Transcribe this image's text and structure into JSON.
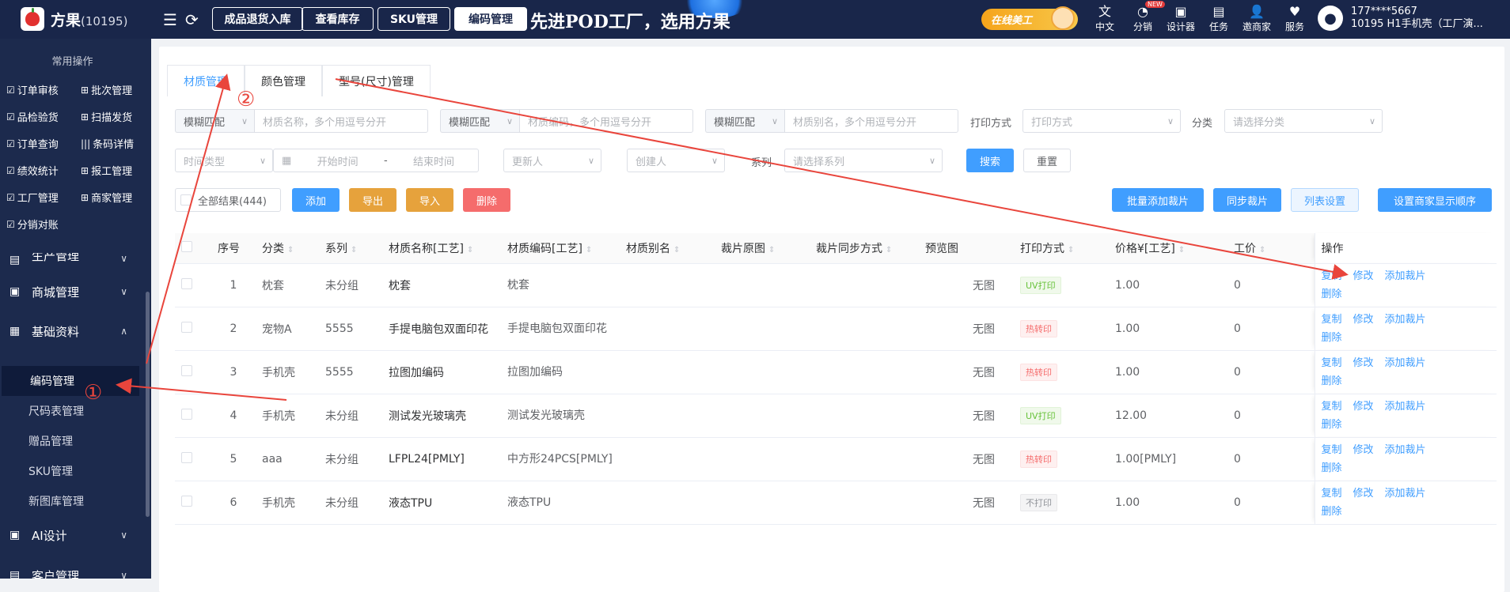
{
  "topbar": {
    "brand": "方果",
    "brand_id": "(10195)",
    "quick_buttons": [
      "成品退货入库",
      "查看库存",
      "SKU管理",
      "编码管理"
    ],
    "slogan": "先进POD工厂，选用方果",
    "online_badge": "在线美工",
    "icons": [
      {
        "label": "中文",
        "icon": "translate-icon"
      },
      {
        "label": "分销",
        "icon": "distribution-icon",
        "badge": "NEW"
      },
      {
        "label": "设计器",
        "icon": "designer-icon"
      },
      {
        "label": "任务",
        "icon": "task-icon"
      },
      {
        "label": "邀商家",
        "icon": "invite-merchant-icon"
      },
      {
        "label": "服务",
        "icon": "service-icon"
      }
    ],
    "user_phone": "177****5667",
    "user_shop": "10195  H1手机壳（工厂演..."
  },
  "sidebar": {
    "common_title": "常用操作",
    "quick": [
      "订单审核",
      "批次管理",
      "品检验货",
      "扫描发货",
      "订单查询",
      "条码详情",
      "绩效统计",
      "报工管理",
      "工厂管理",
      "商家管理",
      "分销对账"
    ],
    "menus": [
      "生产管理",
      "商城管理",
      "基础资料"
    ],
    "sub_items": [
      "编码管理",
      "尺码表管理",
      "赠品管理",
      "SKU管理",
      "新图库管理"
    ],
    "menus_bottom": [
      "AI设计",
      "客户管理"
    ]
  },
  "tabs": [
    "材质管理",
    "颜色管理",
    "型号(尺寸)管理"
  ],
  "filters": {
    "match1": "模糊匹配",
    "material_name_ph": "材质名称，多个用逗号分开",
    "match2": "模糊匹配",
    "material_code_ph": "材质编码，多个用逗号分开",
    "match3": "模糊匹配",
    "material_alias_ph": "材质别名，多个用逗号分开",
    "print_label": "打印方式",
    "print_ph": "打印方式",
    "category_label": "分类",
    "category_ph": "请选择分类",
    "time_type_ph": "时间类型",
    "start_ph": "开始时间",
    "sep": "-",
    "end_ph": "结束时间",
    "updater_ph": "更新人",
    "creator_ph": "创建人",
    "series_label": "系列",
    "series_ph": "请选择系列",
    "search": "搜索",
    "reset": "重置"
  },
  "actions": {
    "all_results": "全部结果(444)",
    "add": "添加",
    "export": "导出",
    "import": "导入",
    "delete": "删除",
    "batch_add_cut": "批量添加裁片",
    "sync_cut": "同步裁片",
    "list_settings": "列表设置",
    "merchant_order": "设置商家显示顺序"
  },
  "table": {
    "headers": [
      "序号",
      "分类",
      "系列",
      "材质名称[工艺]",
      "材质编码[工艺]",
      "材质别名",
      "裁片原图",
      "裁片同步方式",
      "预览图",
      "打印方式",
      "价格¥[工艺]",
      "工价",
      "操作"
    ],
    "rows": [
      {
        "no": "1",
        "category": "枕套",
        "series": "未分组",
        "name": "枕套",
        "code": "枕套",
        "alias": "",
        "preview": "无图",
        "print": "UV打印",
        "print_type": "green",
        "price": "1.00",
        "labor": "0"
      },
      {
        "no": "2",
        "category": "宠物A",
        "series": "5555",
        "name": "手提电脑包双面印花",
        "code": "手提电脑包双面印花",
        "alias": "",
        "preview": "无图",
        "print": "热转印",
        "print_type": "red",
        "price": "1.00",
        "labor": "0"
      },
      {
        "no": "3",
        "category": "手机壳",
        "series": "5555",
        "name": "拉图加编码",
        "code": "拉图加编码",
        "alias": "",
        "preview": "无图",
        "print": "热转印",
        "print_type": "red",
        "price": "1.00",
        "labor": "0"
      },
      {
        "no": "4",
        "category": "手机壳",
        "series": "未分组",
        "name": "测试发光玻璃壳",
        "code": "测试发光玻璃壳",
        "alias": "",
        "preview": "无图",
        "print": "UV打印",
        "print_type": "green",
        "price": "12.00",
        "labor": "0"
      },
      {
        "no": "5",
        "category": "aaa",
        "series": "未分组",
        "name": "LFPL24[PMLY]",
        "code": "中方形24PCS[PMLY]",
        "alias": "",
        "preview": "无图",
        "print": "热转印",
        "print_type": "red",
        "price": "1.00[PMLY]",
        "labor": "0"
      },
      {
        "no": "6",
        "category": "手机壳",
        "series": "未分组",
        "name": "液态TPU",
        "code": "液态TPU",
        "alias": "",
        "preview": "无图",
        "print": "不打印",
        "print_type": "gray",
        "price": "1.00",
        "labor": "0"
      }
    ],
    "ops": [
      "复制",
      "修改",
      "添加裁片",
      "删除"
    ]
  },
  "annotations": {
    "one": "①",
    "two": "②"
  },
  "colors": {
    "topbar": "#19264a",
    "sidebar": "#1c2a4d",
    "primary": "#409eff",
    "annotation": "#e9453c"
  }
}
